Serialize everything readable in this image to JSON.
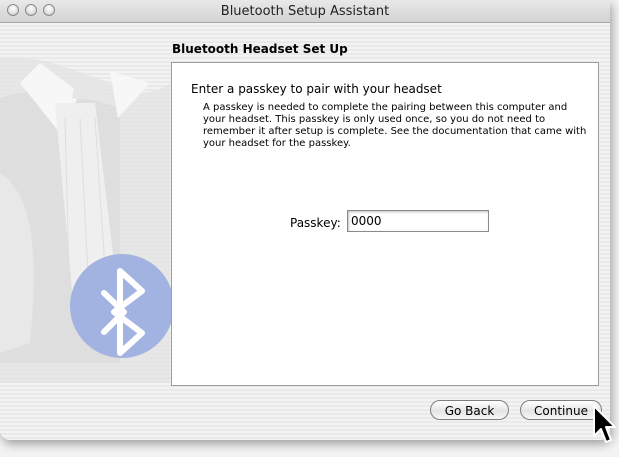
{
  "window": {
    "title": "Bluetooth Setup Assistant"
  },
  "section": {
    "title": "Bluetooth Headset Set Up"
  },
  "panel": {
    "heading": "Enter a passkey to pair with your headset",
    "description": "A passkey is needed to complete the pairing between this computer and your headset. This passkey is only used once, so you do not need to remember it after setup is complete. See the documentation that came with your headset for the passkey."
  },
  "passkey": {
    "label": "Passkey:",
    "value": "0000"
  },
  "buttons": {
    "back_label": "Go Back",
    "continue_label": "Continue"
  },
  "colors": {
    "bluetooth_blue": "#9fb2e2",
    "panel_border": "#9c9c9c"
  },
  "icons": {
    "decoration": "bluetooth-tuxedo-illustration",
    "cursor": "arrow-cursor"
  }
}
